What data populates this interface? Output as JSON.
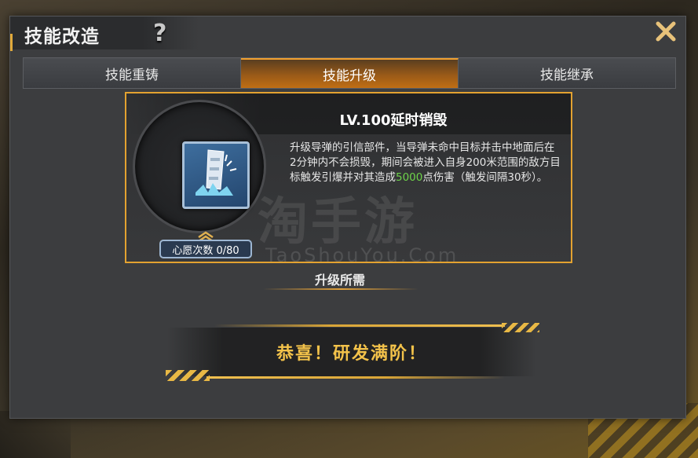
{
  "dialog": {
    "title": "技能改造",
    "help_icon": "?",
    "close_icon": "close-icon"
  },
  "tabs": [
    {
      "label": "技能重铸",
      "active": false
    },
    {
      "label": "技能升级",
      "active": true
    },
    {
      "label": "技能继承",
      "active": false
    }
  ],
  "skill": {
    "name": "LV.100延时销毁",
    "desc_part1": "升级导弹的引信部件，当导弹未命中目标并击中地面后在2分钟内不会损毁，期间会被进入自身200米范围的敌方目标触发引爆并对其造成",
    "desc_highlight": "5000",
    "desc_part2": "点伤害（触发间隔30秒）。",
    "wish_count": "心愿次数 0/80"
  },
  "watermark": {
    "main": "淘手游",
    "sub": "TaoShouYou.Com"
  },
  "requirements": {
    "title": "升级所需"
  },
  "banner": {
    "text": "恭喜！研发满阶！"
  },
  "colors": {
    "accent": "#e3a230",
    "highlight": "#6ed34a",
    "banner_text": "#f3c24a"
  }
}
